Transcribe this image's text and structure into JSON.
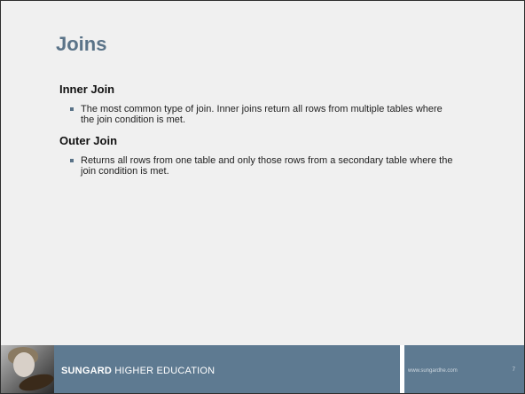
{
  "slide": {
    "title": "Joins",
    "sections": [
      {
        "heading": "Inner Join",
        "bullet": "The most common type of join.  Inner joins return all rows from multiple tables where the join condition is met."
      },
      {
        "heading": "Outer Join",
        "bullet": "Returns all rows from one table and only those rows from a secondary table where the join condition is met."
      }
    ]
  },
  "footer": {
    "brand_strong": "SUNGARD",
    "brand_rest": " HIGHER EDUCATION",
    "url": "www.sungardhe.com",
    "page_number": "7"
  },
  "colors": {
    "accent": "#5a7388",
    "band": "#5e7a91"
  }
}
